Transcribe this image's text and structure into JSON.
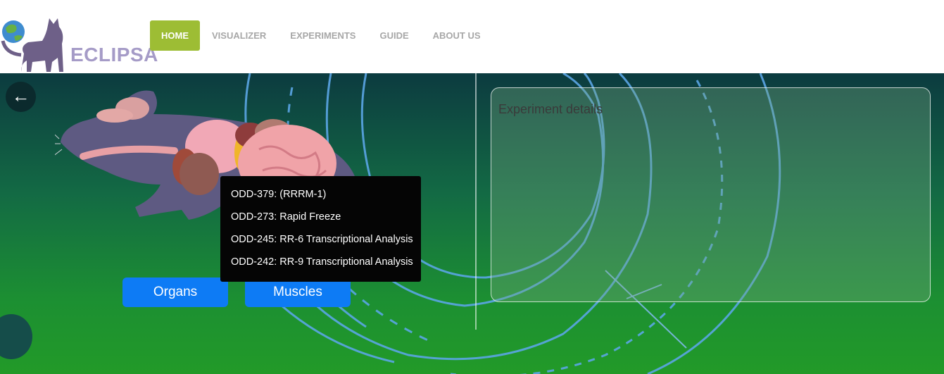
{
  "app": {
    "name": "ECLIPSA"
  },
  "nav": {
    "items": [
      {
        "label": "HOME"
      },
      {
        "label": "VISUALIZER"
      },
      {
        "label": "EXPERIMENTS"
      },
      {
        "label": "GUIDE"
      },
      {
        "label": "ABOUT US"
      }
    ]
  },
  "main": {
    "back_icon": "left-arrow-icon",
    "buttons": {
      "organs": "Organs",
      "muscles": "Muscles"
    },
    "dropdown": {
      "items": [
        "ODD-379: (RRRM-1)",
        "ODD-273: Rapid Freeze",
        "ODD-245: RR-6 Transcriptional Analysis",
        "ODD-242: RR-9 Transcriptional Analysis"
      ]
    },
    "details": {
      "title": "Experiment details"
    }
  },
  "colors": {
    "accent": "#9dbd34",
    "button_blue": "#0d7bf5",
    "logo_purple": "#a59bc7"
  }
}
